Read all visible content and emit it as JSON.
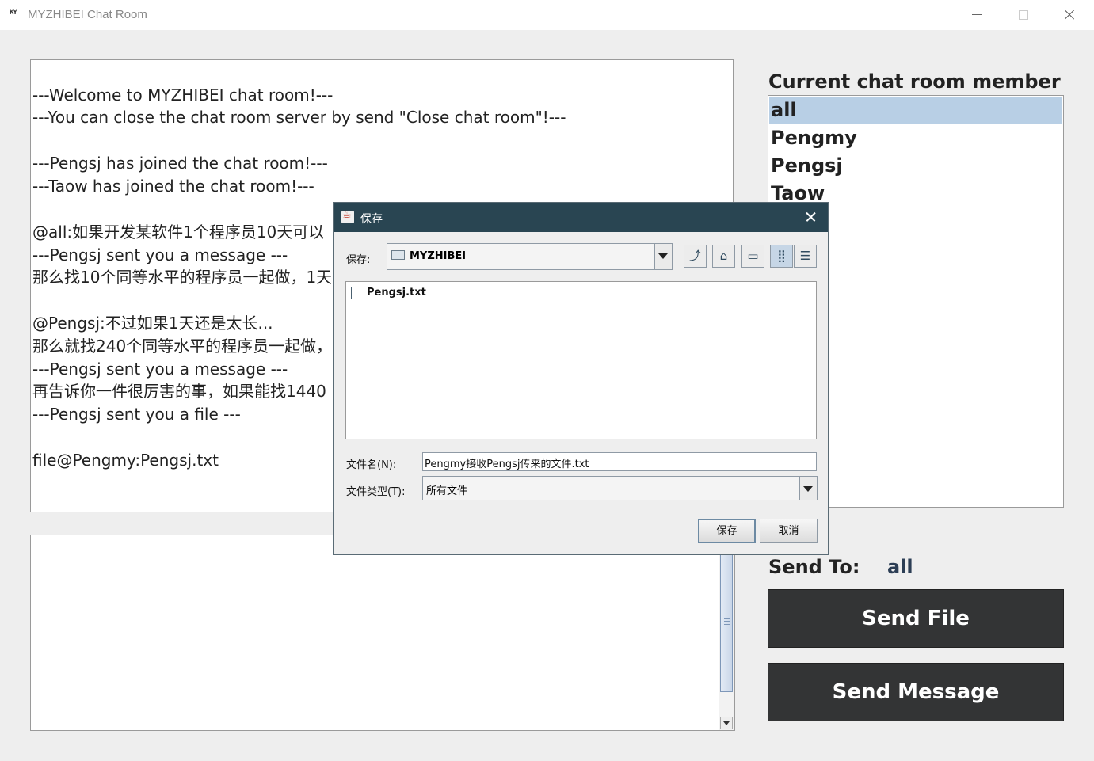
{
  "window": {
    "title": "MYZHIBEI Chat Room",
    "icon_label": "KY"
  },
  "chat": {
    "lines": [
      "---Welcome to MYZHIBEI chat room!---",
      "---You can close the chat room server by send \"Close chat room\"!---",
      "",
      "---Pengsj has joined the chat room!---",
      "---Taow has joined the chat room!---",
      "",
      "@all:如果开发某软件1个程序员10天可以",
      "---Pengsj sent you a message ---",
      "那么找10个同等水平的程序员一起做，1天",
      "",
      "@Pengsj:不过如果1天还是太长...",
      "那么就找240个同等水平的程序员一起做，",
      "---Pengsj sent you a message ---",
      "再告诉你一件很厉害的事，如果能找1440",
      "---Pengsj sent you a file ---",
      "",
      "file@Pengmy:Pengsj.txt"
    ]
  },
  "members": {
    "title": "Current chat room member",
    "items": [
      "all",
      "Pengmy",
      "Pengsj",
      "Taow"
    ],
    "selected": "all",
    "selected_color": "#b8cfe5"
  },
  "send_to": {
    "label": "Send To:",
    "value": "all"
  },
  "buttons": {
    "send_file": "Send File",
    "send_message": "Send Message"
  },
  "dialog": {
    "title": "保存",
    "save_in_label": "保存:",
    "folder": "MYZHIBEI",
    "toolbar_icons": [
      "up-folder-icon",
      "home-icon",
      "new-folder-icon",
      "list-view-icon",
      "details-view-icon"
    ],
    "files": [
      "Pengsj.txt"
    ],
    "filename_label": "文件名(N):",
    "filename_value": "Pengmy接收Pengsj传来的文件.txt",
    "filetype_label": "文件类型(T):",
    "filetype_value": "所有文件",
    "save_button": "保存",
    "cancel_button": "取消",
    "titlebar_color": "#294552"
  }
}
